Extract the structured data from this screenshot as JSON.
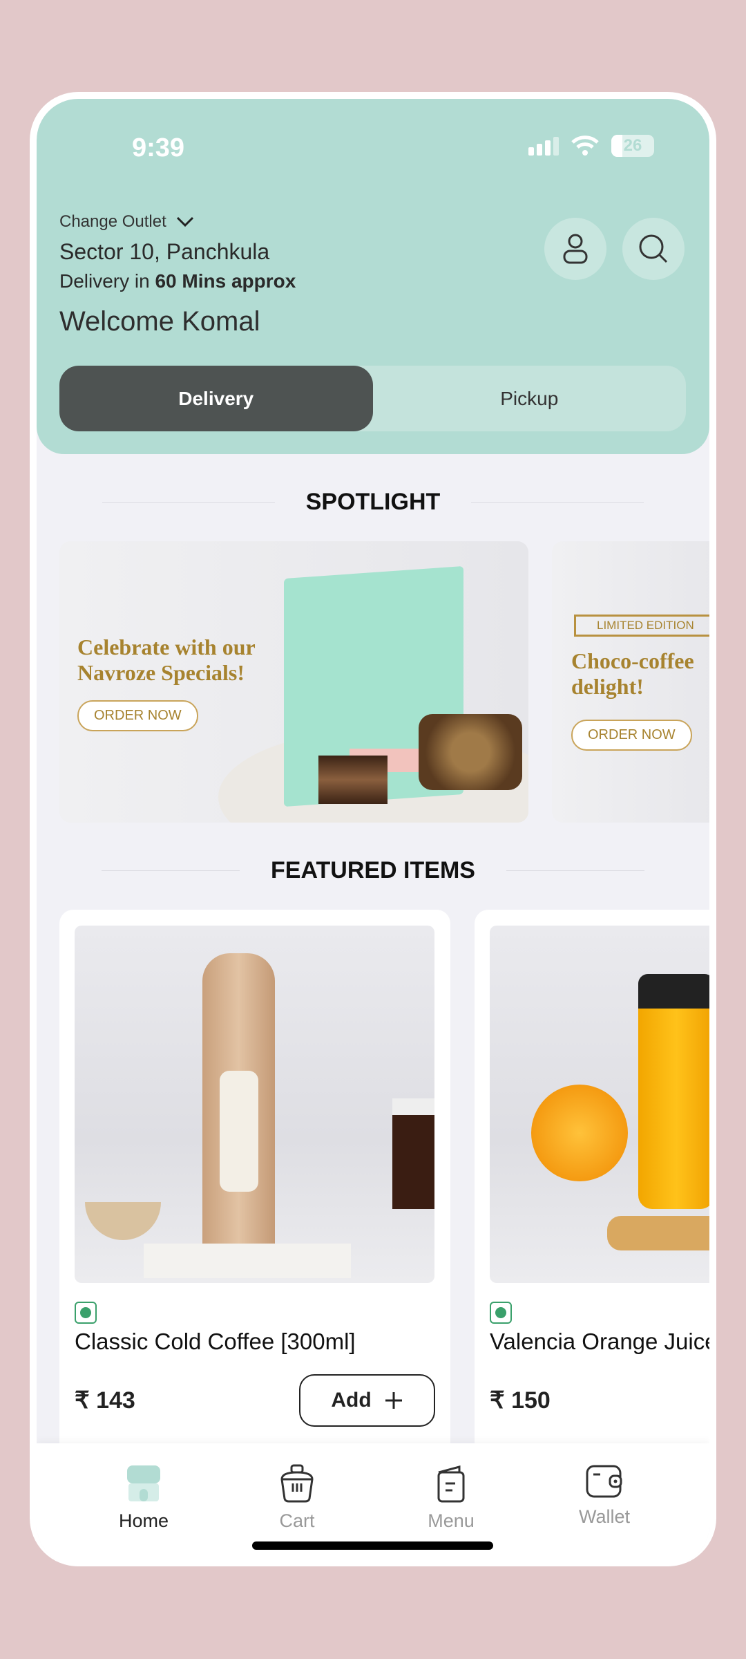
{
  "status_bar": {
    "time": "9:39",
    "battery": "26"
  },
  "header": {
    "change_outlet": "Change Outlet",
    "address": "Sector 10, Panchkula",
    "delivery_prefix": "Delivery in ",
    "delivery_time": "60 Mins approx",
    "welcome": "Welcome Komal",
    "toggle": {
      "delivery": "Delivery",
      "pickup": "Pickup",
      "selected": "Delivery"
    }
  },
  "spotlight": {
    "title": "SPOTLIGHT",
    "banners": [
      {
        "line1": "Celebrate with our",
        "line2": "Navroze Specials!",
        "cta": "ORDER NOW"
      },
      {
        "badge": "LIMITED EDITION",
        "line1": "Choco-coffee",
        "line2": "delight!",
        "cta": "ORDER NOW"
      }
    ]
  },
  "featured": {
    "title": "FEATURED ITEMS",
    "items": [
      {
        "name": "Classic Cold Coffee [300ml]",
        "price": "₹ 143",
        "add_label": "Add",
        "veg": true
      },
      {
        "name": "Valencia Orange Juice",
        "price": "₹ 150",
        "veg": true
      }
    ]
  },
  "nav": {
    "items": [
      {
        "label": "Home",
        "active": true
      },
      {
        "label": "Cart"
      },
      {
        "label": "Menu"
      },
      {
        "label": "Wallet"
      }
    ]
  },
  "colors": {
    "header": "#b2dcd3",
    "toggle_active": "#4e5352",
    "veg": "#3aa06b",
    "banner_text": "#a7832f"
  }
}
